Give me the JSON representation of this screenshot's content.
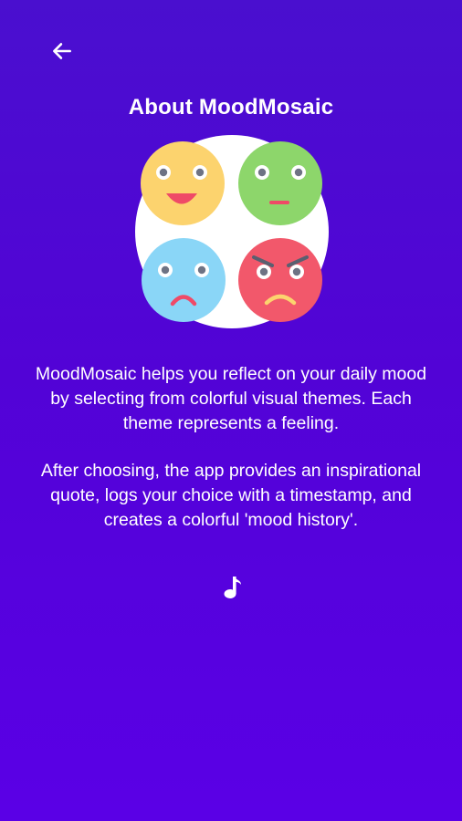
{
  "screen": {
    "title": "About MoodMosaic",
    "back_icon": "arrow-left-icon",
    "logo_icon": "mood-mosaic-logo-icon",
    "music_icon": "music-note-icon"
  },
  "description": {
    "paragraph_1": "MoodMosaic helps you reflect on your daily mood by selecting from colorful visual themes. Each theme represents a feeling.",
    "paragraph_2": "After choosing, the app provides an inspirational quote, logs your choice with a timestamp, and creates a colorful 'mood history'."
  },
  "colors": {
    "background_top": "#4a0fcf",
    "background_bottom": "#5a00e6",
    "text": "#ffffff",
    "happy_face": "#fcd36e",
    "neutral_face": "#8dd66b",
    "sad_face": "#8ad6f7",
    "angry_face": "#f2586b"
  }
}
